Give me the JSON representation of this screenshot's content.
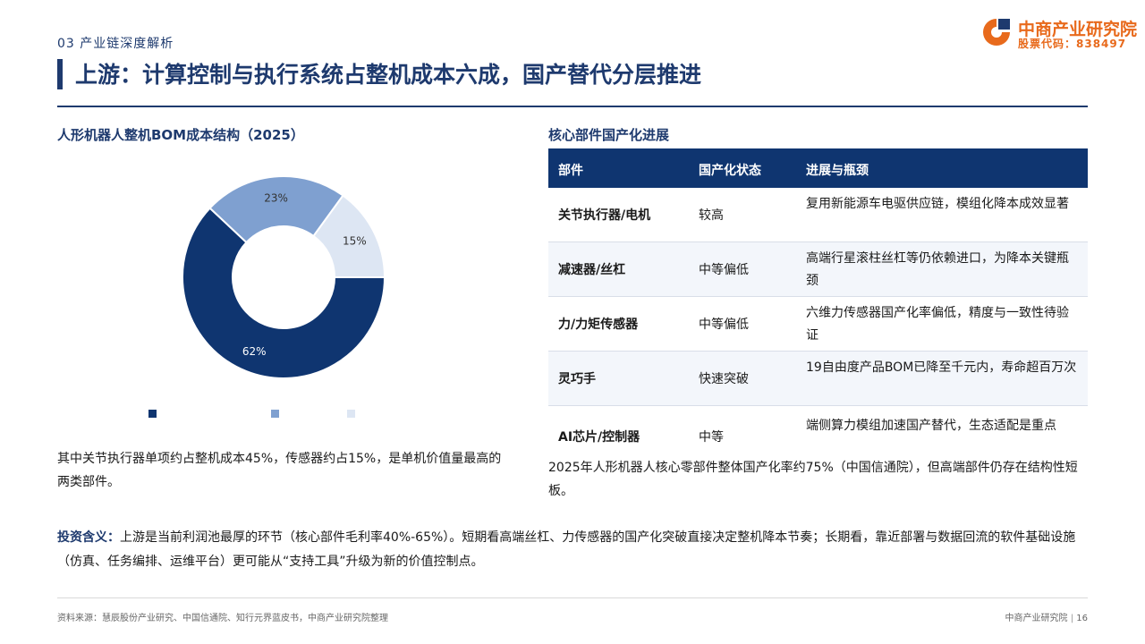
{
  "header": {
    "section_label": "03 产业链深度解析",
    "title": "上游：计算控制与执行系统占整机成本六成，国产替代分层推进",
    "logo_name": "中商产业研究院",
    "logo_code": "股票代码：838497",
    "brand_colors": {
      "navy": "#1e3a6e",
      "orange": "#e86a1c"
    }
  },
  "chart_data": {
    "type": "pie",
    "title": "人形机器人整机BOM成本结构（2025）",
    "categories": [
      "",
      "",
      ""
    ],
    "values": [
      62,
      23,
      15
    ],
    "value_labels": [
      "62%",
      "23%",
      "15%"
    ],
    "colors": [
      "#0f3570",
      "#7fa0d0",
      "#dde6f3"
    ],
    "legend": "bottom"
  },
  "chart_note": "其中关节执行器单项约占整机成本45%，传感器约占15%，是单机价值量最高的两类部件。",
  "table": {
    "title": "核心部件国产化进展",
    "headers": [
      "部件",
      "国产化状态",
      "进展与瓶颈"
    ],
    "rows": [
      {
        "part": "关节执行器/电机",
        "status": "较高",
        "desc": "复用新能源车电驱供应链，模组化降本成效显著"
      },
      {
        "part": "减速器/丝杠",
        "status": "中等偏低",
        "desc": "高端行星滚柱丝杠等仍依赖进口，为降本关键瓶颈"
      },
      {
        "part": "力/力矩传感器",
        "status": "中等偏低",
        "desc": "六维力传感器国产化率偏低，精度与一致性待验证"
      },
      {
        "part": "灵巧手",
        "status": "快速突破",
        "desc": "19自由度产品BOM已降至千元内，寿命超百万次"
      },
      {
        "part": "AI芯片/控制器",
        "status": "中等",
        "desc": "端侧算力模组加速国产替代，生态适配是重点"
      }
    ],
    "note": "2025年人形机器人核心零部件整体国产化率约75%（中国信通院），但高端部件仍存在结构性短板。"
  },
  "investment": {
    "label": "投资含义：",
    "text": "上游是当前利润池最厚的环节（核心部件毛利率40%-65%）。短期看高端丝杠、力传感器的国产化突破直接决定整机降本节奏；长期看，靠近部署与数据回流的软件基础设施（仿真、任务编排、运维平台）更可能从“支持工具”升级为新的价值控制点。"
  },
  "footer": {
    "source": "资料来源：慧辰股份产业研究、中国信通院、知行元界蓝皮书，中商产业研究院整理",
    "org": "中商产业研究院",
    "page": "16"
  }
}
